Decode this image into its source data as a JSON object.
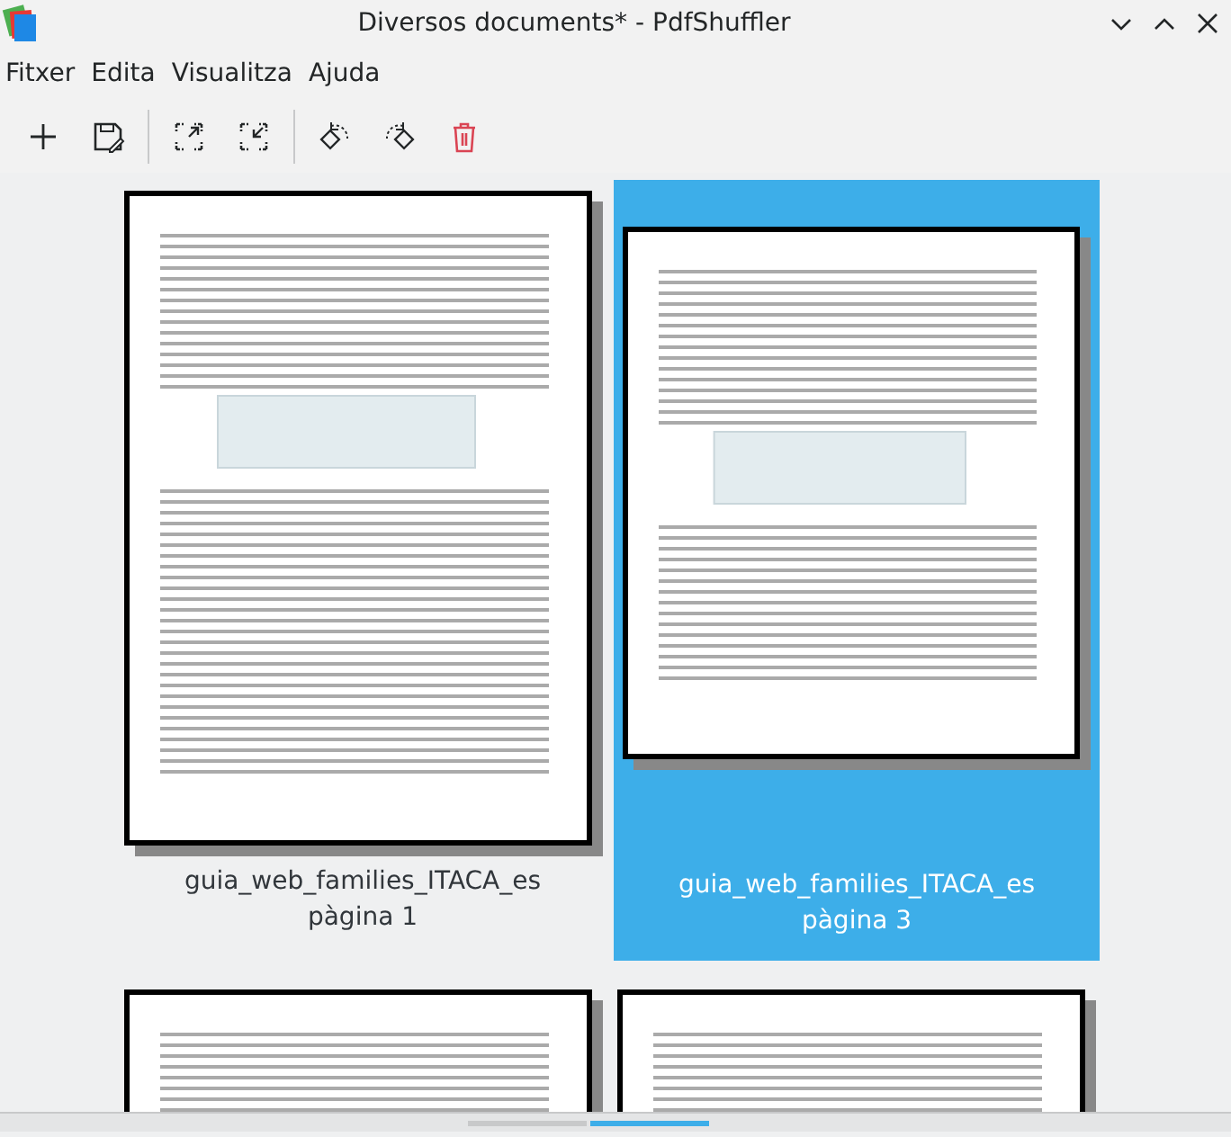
{
  "window": {
    "title": "Diversos documents* - PdfShuffler"
  },
  "menu": [
    "Fitxer",
    "Edita",
    "Visualitza",
    "Ajuda"
  ],
  "toolbar": [
    {
      "kind": "add"
    },
    {
      "kind": "save"
    },
    {
      "kind": "sep"
    },
    {
      "kind": "zoom-in"
    },
    {
      "kind": "zoom-out"
    },
    {
      "kind": "sep"
    },
    {
      "kind": "rotate-left"
    },
    {
      "kind": "rotate-right"
    },
    {
      "kind": "delete"
    }
  ],
  "pages": [
    {
      "document": "guia_web_families_ITACA_es",
      "page": "pàgina 1",
      "selected": false,
      "kind": "tall"
    },
    {
      "document": "guia_web_families_ITACA_es",
      "page": "pàgina 3",
      "selected": true,
      "kind": "wide"
    },
    {
      "selected": false,
      "kind": "tall"
    },
    {
      "selected": false,
      "kind": "tall"
    }
  ]
}
